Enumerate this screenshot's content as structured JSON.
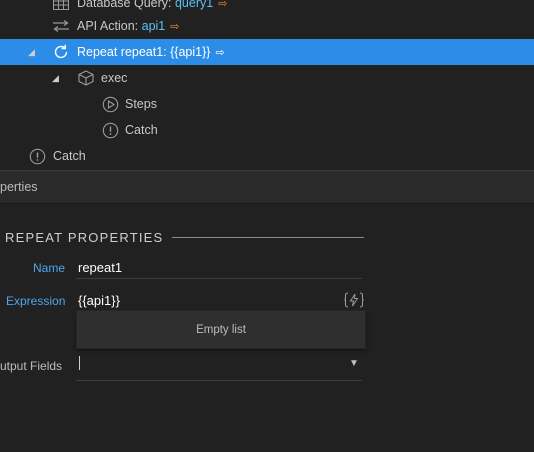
{
  "tree": {
    "rows": [
      {
        "label_prefix": "Database Query: ",
        "value": "query1",
        "icon": "database-grid-icon",
        "link_icon": "link-arrow-icon"
      },
      {
        "label_prefix": "API Action: ",
        "value": "api1",
        "icon": "api-exchange-icon",
        "link_icon": "link-arrow-icon"
      },
      {
        "label_prefix": "Repeat repeat1: ",
        "value": "{{api1}}",
        "icon": "repeat-icon",
        "link_icon": "link-arrow-icon",
        "selected": true,
        "expanded": true
      },
      {
        "label": "exec",
        "icon": "cube-icon",
        "expanded": true
      },
      {
        "label": "Steps",
        "icon": "play-circle-icon"
      },
      {
        "label": "Catch",
        "icon": "alert-circle-icon"
      },
      {
        "label": "Catch",
        "icon": "alert-circle-icon"
      }
    ]
  },
  "panel": {
    "header_title": "perties",
    "section_title": "REPEAT PROPERTIES",
    "fields": {
      "name": {
        "label": "Name",
        "value": "repeat1"
      },
      "expression": {
        "label": "Expression",
        "value": "{{api1}}",
        "icon": "flash-braces-icon"
      },
      "output_fields": {
        "label": "utput Fields",
        "value": "",
        "icon": "chevron-down-icon"
      }
    },
    "dropdown_empty_text": "Empty list"
  },
  "colors": {
    "selected_row": "#2b8de8",
    "field_label": "#4ea6ee",
    "link_icon": "#f08a24",
    "highlight_value": "#5bc0f2",
    "background": "#212121"
  }
}
